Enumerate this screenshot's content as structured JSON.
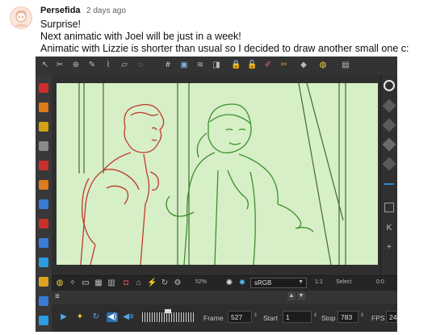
{
  "post": {
    "username": "Persefida",
    "timestamp": "2 days ago",
    "lines": [
      "Surprise!",
      "Next animatic with Joel will be just in a week!",
      "Animatic with Lizzie is shorter than usual so I decided to draw another small one c:"
    ]
  },
  "app": {
    "canvas": {
      "background_color": "#d6efc7",
      "characters": [
        {
          "name": "red-character",
          "color": "#c0392b"
        },
        {
          "name": "green-character",
          "color": "#3e8f2a"
        }
      ]
    },
    "status_bar": {
      "zoom": "52%",
      "color_space": "sRGB",
      "ratio": "1:1",
      "select": "Select",
      "right_value": "0:0"
    },
    "playback": {
      "frame_label": "Frame",
      "frame_value": "527",
      "start_label": "Start",
      "start_value": "1",
      "stop_label": "Stop",
      "stop_value": "783",
      "fps_label": "FPS",
      "fps_value": "24"
    },
    "colors": {
      "accent": "#2a6fb0",
      "panel": "#2d2d2d"
    }
  }
}
